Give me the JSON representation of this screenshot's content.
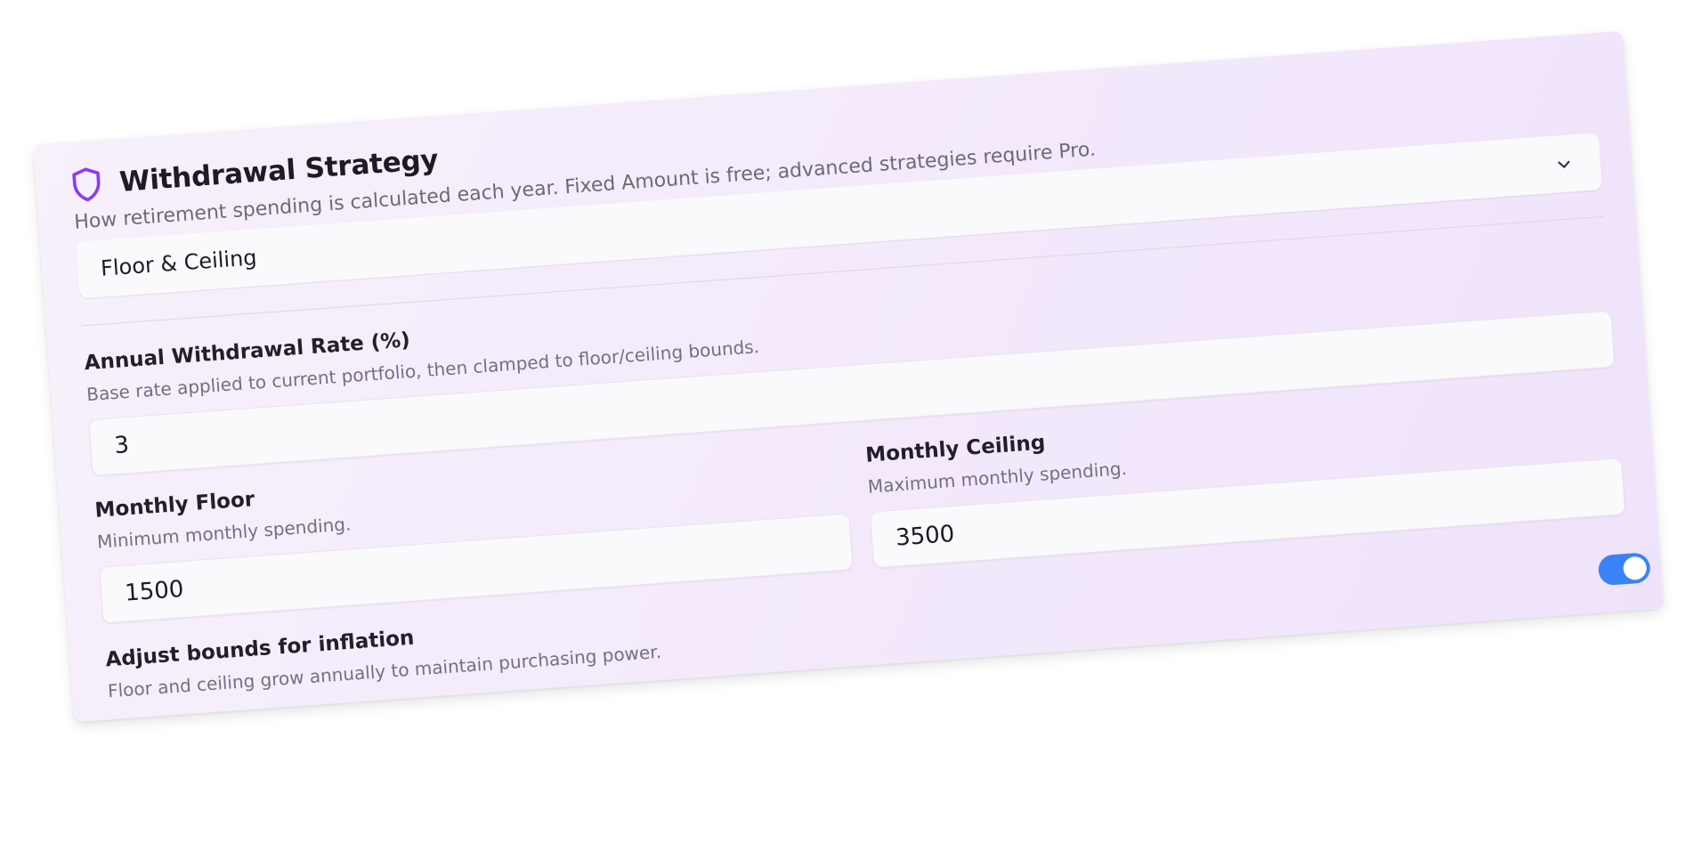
{
  "section": {
    "title": "Withdrawal Strategy",
    "description": "How retirement spending is calculated each year. Fixed Amount is free; advanced strategies require Pro.",
    "icon": "shield-icon",
    "accent_color": "#8b3cf0"
  },
  "strategy_select": {
    "value": "Floor & Ceiling",
    "icon": "chevron-down-icon"
  },
  "withdrawal_rate": {
    "label": "Annual Withdrawal Rate (%)",
    "description": "Base rate applied to current portfolio, then clamped to floor/ceiling bounds.",
    "value": "3"
  },
  "monthly_floor": {
    "label": "Monthly Floor",
    "description": "Minimum monthly spending.",
    "value": "1500"
  },
  "monthly_ceiling": {
    "label": "Monthly Ceiling",
    "description": "Maximum monthly spending.",
    "value": "3500"
  },
  "inflation_adjust": {
    "label": "Adjust bounds for inflation",
    "description": "Floor and ceiling grow annually to maintain purchasing power.",
    "enabled": true,
    "toggle_color": "#3b82f6"
  }
}
